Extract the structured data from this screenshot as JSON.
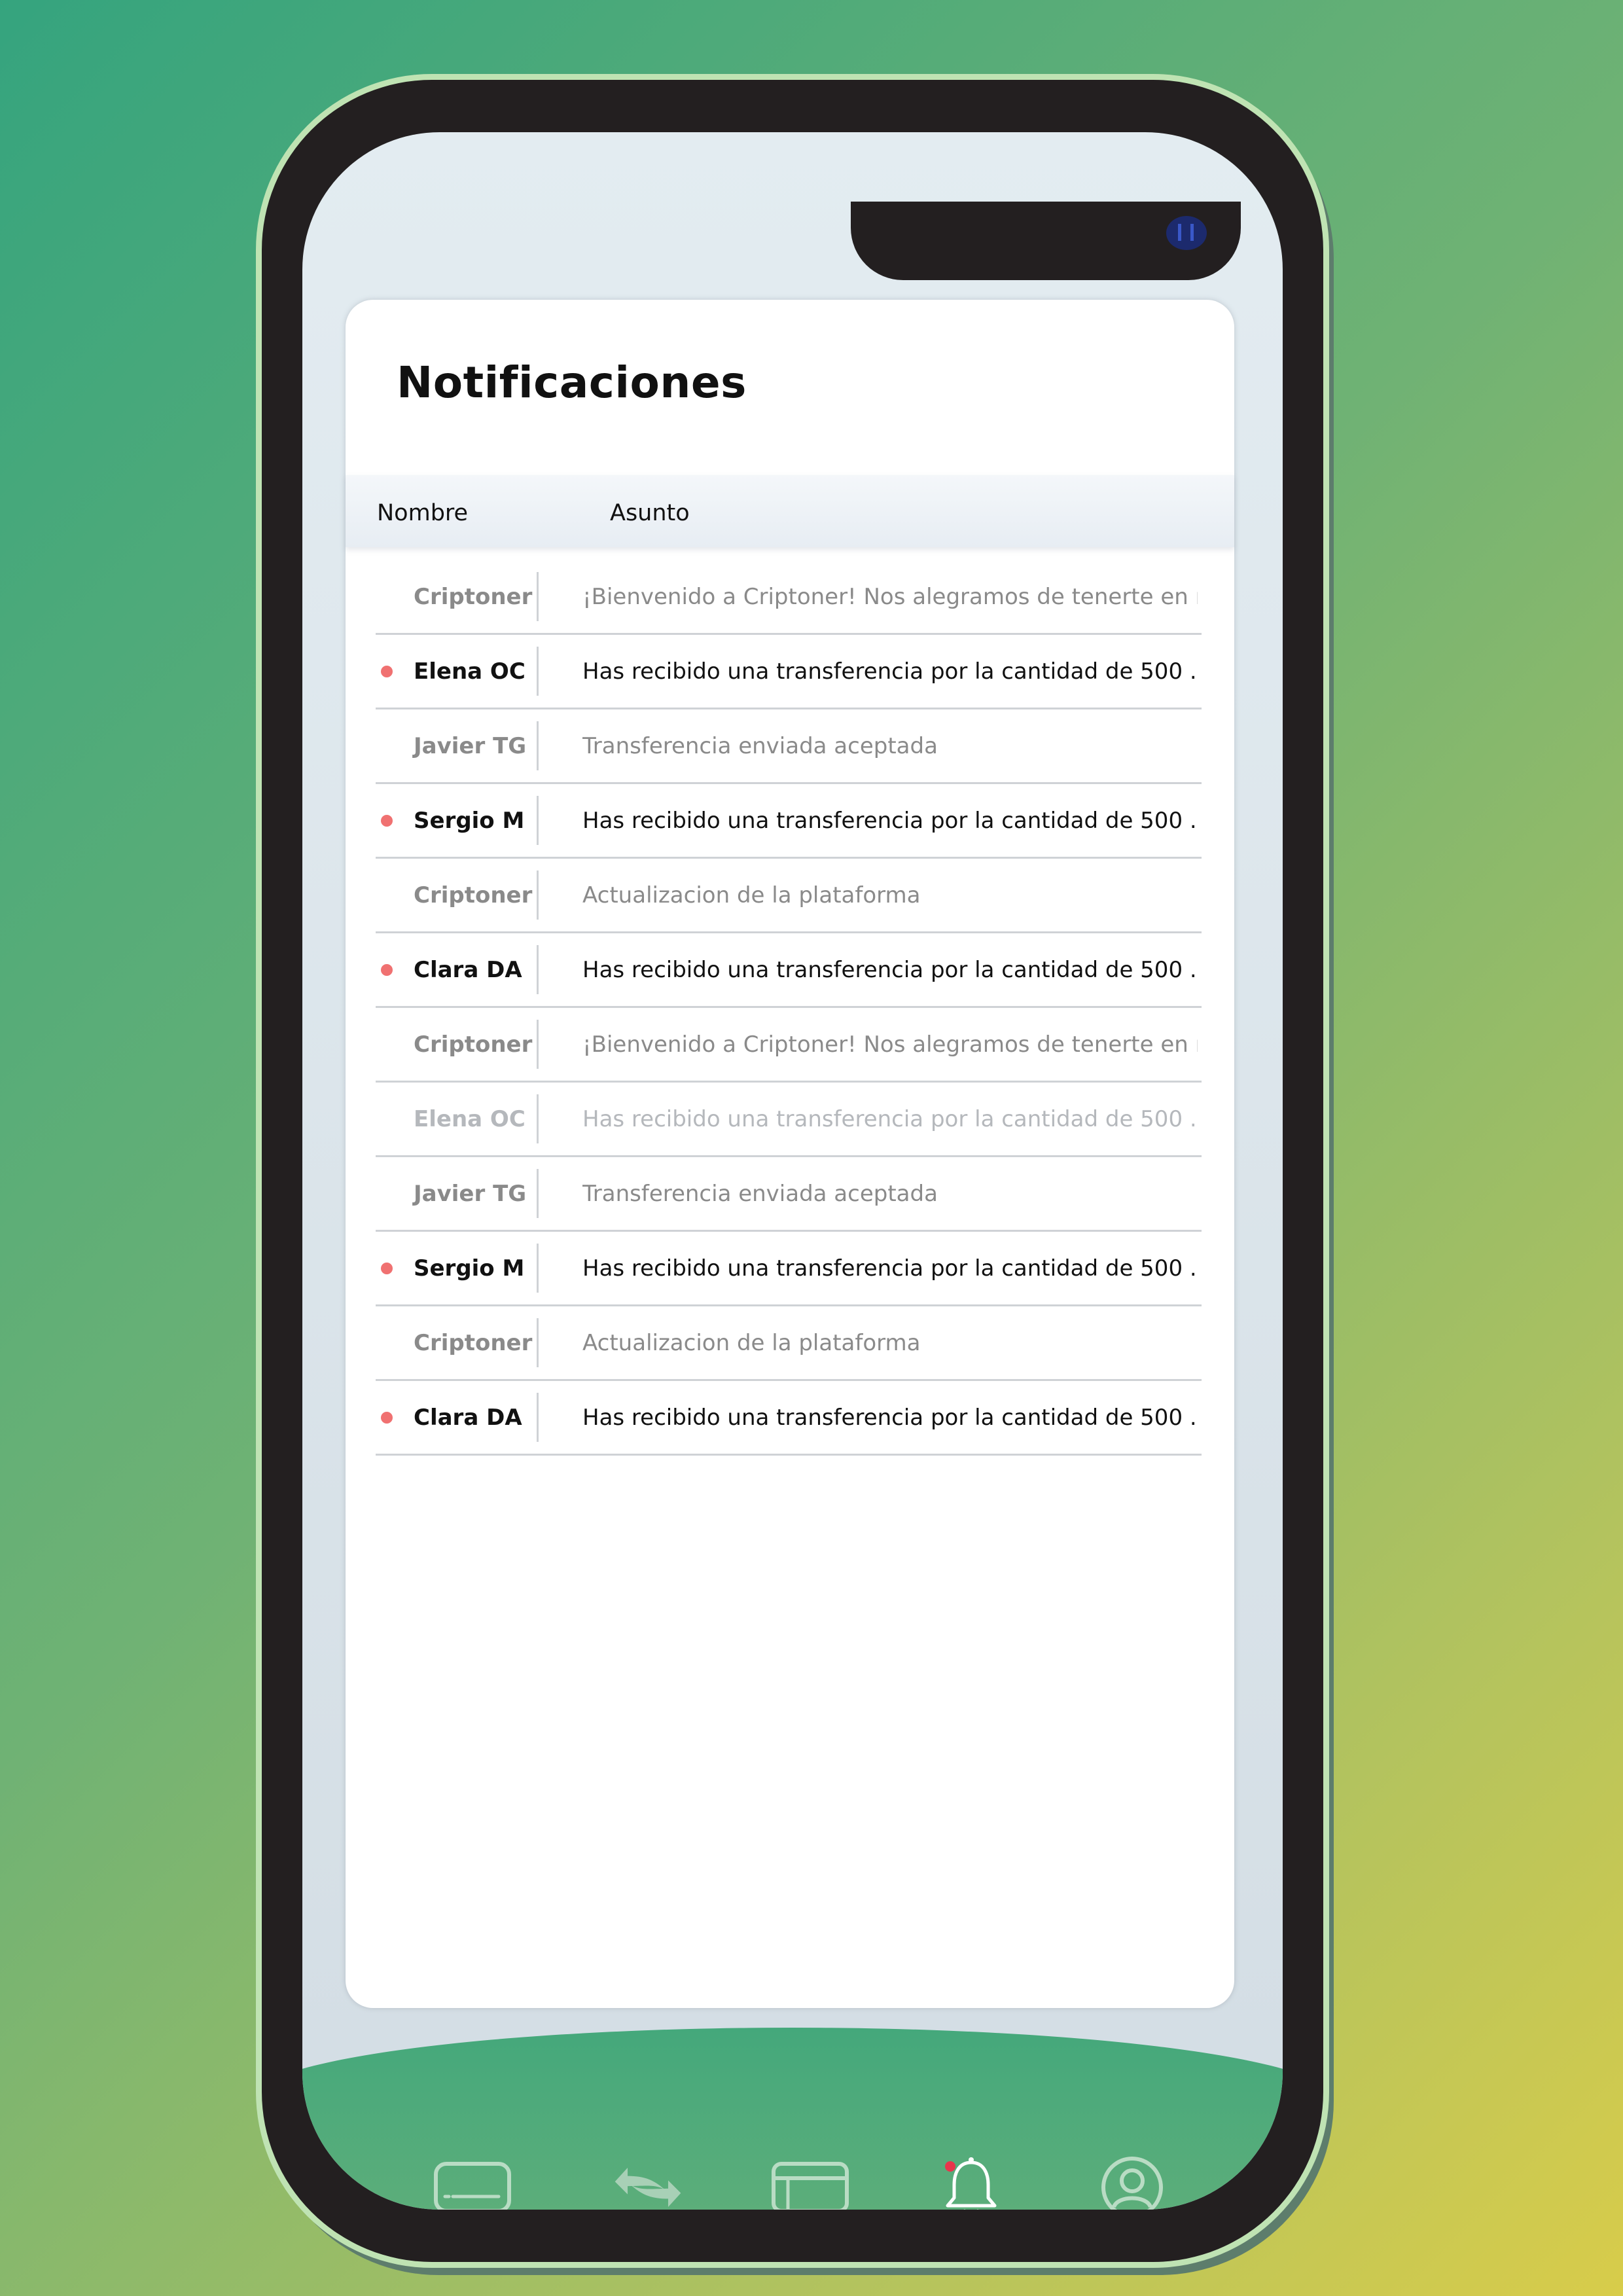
{
  "screen": {
    "title": "Notificaciones",
    "columns": {
      "name": "Nombre",
      "subject": "Asunto"
    }
  },
  "notifications": [
    {
      "name": "Criptoner",
      "subject": "¡Bienvenido a Criptoner! Nos alegramos de tenerte en nu...",
      "unread": false,
      "state": "read"
    },
    {
      "name": "Elena OC",
      "subject": "Has recibido una transferencia por la cantidad de 500 ...",
      "unread": true,
      "state": "unread"
    },
    {
      "name": "Javier TG",
      "subject": "Transferencia enviada aceptada",
      "unread": false,
      "state": "read"
    },
    {
      "name": "Sergio M",
      "subject": "Has recibido una transferencia por la cantidad de 500 ...",
      "unread": true,
      "state": "unread"
    },
    {
      "name": "Criptoner",
      "subject": "Actualizacion de la plataforma",
      "unread": false,
      "state": "read"
    },
    {
      "name": "Clara DA",
      "subject": "Has recibido una transferencia por la cantidad de 500 ...",
      "unread": true,
      "state": "unread"
    },
    {
      "name": "Criptoner",
      "subject": "¡Bienvenido a Criptoner! Nos alegramos de tenerte en nu...",
      "unread": false,
      "state": "read"
    },
    {
      "name": "Elena OC",
      "subject": "Has recibido una transferencia por la cantidad de 500 ...",
      "unread": false,
      "state": "faded"
    },
    {
      "name": "Javier TG",
      "subject": "Transferencia enviada aceptada",
      "unread": false,
      "state": "read"
    },
    {
      "name": "Sergio M",
      "subject": "Has recibido una transferencia por la cantidad de 500 ...",
      "unread": true,
      "state": "unread"
    },
    {
      "name": "Criptoner",
      "subject": "Actualizacion de la plataforma",
      "unread": false,
      "state": "read"
    },
    {
      "name": "Clara DA",
      "subject": "Has recibido una transferencia por la cantidad de 500 ...",
      "unread": true,
      "state": "unread"
    }
  ],
  "bottom_nav": [
    {
      "icon": "wallet-icon",
      "active": false
    },
    {
      "icon": "transfer-icon",
      "active": false
    },
    {
      "icon": "card-icon",
      "active": false
    },
    {
      "icon": "bell-icon",
      "active": true,
      "has_badge": true
    },
    {
      "icon": "profile-icon",
      "active": false
    }
  ],
  "colors": {
    "unread_dot": "#f07171",
    "nav_green": "#44a87b",
    "text_primary": "#111111",
    "text_muted": "#8a8a8a"
  }
}
